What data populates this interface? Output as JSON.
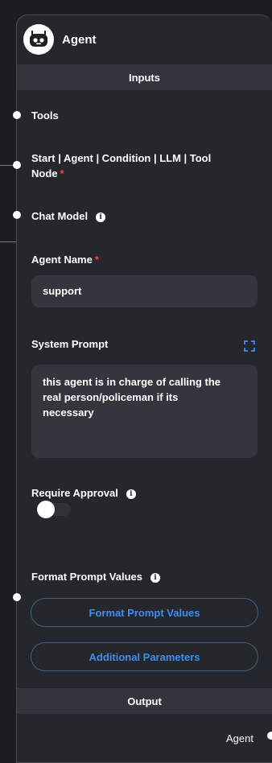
{
  "node": {
    "title": "Agent",
    "icon": "robot-icon"
  },
  "inputs_header": "Inputs",
  "anchors": {
    "tools": "Tools",
    "start_line1": "Start | Agent | Condition | LLM | Tool",
    "start_line2": "Node",
    "chat_model": "Chat Model"
  },
  "agent_name": {
    "label": "Agent Name",
    "value": "support"
  },
  "system_prompt": {
    "label": "System Prompt",
    "line1": "this agent is in charge of calling the",
    "line2": "real person/policeman if its",
    "line3": "necessary"
  },
  "require_approval": {
    "label": "Require Approval",
    "enabled": false
  },
  "format_prompt_values": {
    "label": "Format Prompt Values",
    "button": "Format Prompt Values"
  },
  "additional_parameters_button": "Additional Parameters",
  "output_header": "Output",
  "output_anchor": "Agent",
  "required_mark": "*",
  "info_glyph": "i",
  "colors": {
    "accent": "#3d8ef0",
    "required": "#ff3d3d",
    "card": "#25272c",
    "section": "#32353b"
  }
}
